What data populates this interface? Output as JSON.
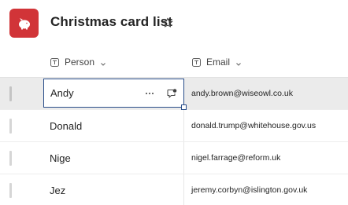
{
  "header": {
    "title": "Christmas card list",
    "app_icon": "piggy-bank-icon",
    "app_icon_color": "#d13438",
    "favorite_icon": "star-icon"
  },
  "columns": [
    {
      "label": "Person",
      "type_icon": "text-type-icon"
    },
    {
      "label": "Email",
      "type_icon": "text-type-icon"
    }
  ],
  "rows": [
    {
      "person": "Andy",
      "email": "andy.brown@wiseowl.co.uk",
      "selected": true
    },
    {
      "person": "Donald",
      "email": "donald.trump@whitehouse.gov.us",
      "selected": false
    },
    {
      "person": "Nige",
      "email": "nigel.farrage@reform.uk",
      "selected": false
    },
    {
      "person": "Jez",
      "email": "jeremy.corbyn@islington.gov.uk",
      "selected": false
    }
  ],
  "colors": {
    "selected_row_bg": "#ebebeb",
    "selected_cell_border": "#2a4e8a"
  }
}
